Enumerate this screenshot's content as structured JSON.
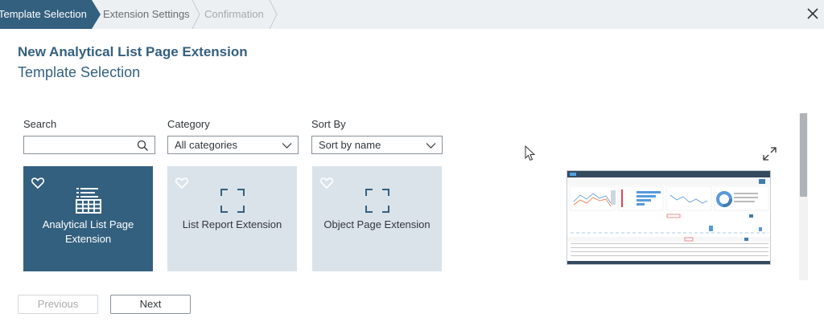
{
  "wizard": {
    "steps": [
      {
        "label": "Template Selection",
        "state": "active"
      },
      {
        "label": "Extension Settings",
        "state": "upcoming"
      },
      {
        "label": "Confirmation",
        "state": "disabled"
      }
    ]
  },
  "header": {
    "title": "New Analytical List Page Extension",
    "subtitle": "Template Selection"
  },
  "filters": {
    "search": {
      "label": "Search",
      "value": "",
      "placeholder": ""
    },
    "category": {
      "label": "Category",
      "value": "All categories"
    },
    "sort": {
      "label": "Sort By",
      "value": "Sort by name"
    }
  },
  "tiles": [
    {
      "label": "Analytical List Page Extension",
      "icon": "table-list-icon",
      "selected": true
    },
    {
      "label": "List Report Extension",
      "icon": "frame-icon",
      "selected": false
    },
    {
      "label": "Object Page Extension",
      "icon": "frame-icon",
      "selected": false
    }
  ],
  "footer": {
    "previous": "Previous",
    "next": "Next"
  },
  "colors": {
    "brand": "#34607f",
    "tile_bg": "#dbe3ea",
    "bar_bg": "#edf0f3"
  }
}
